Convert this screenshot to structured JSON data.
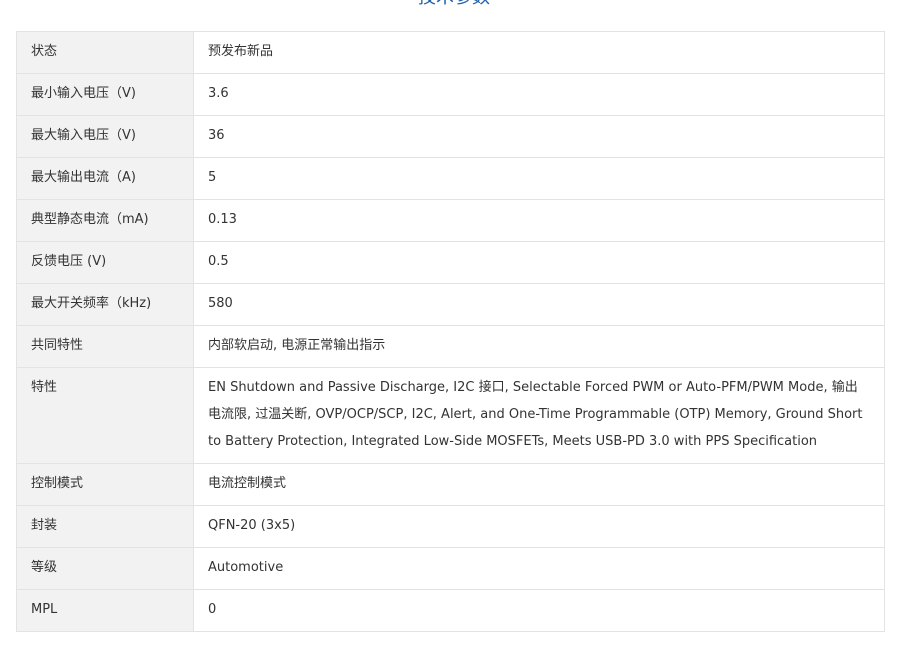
{
  "section": {
    "title": "技术参数"
  },
  "specs": [
    {
      "key": "状态",
      "value": "预发布新品"
    },
    {
      "key": "最小输入电压（V)",
      "value": "3.6"
    },
    {
      "key": "最大输入电压（V)",
      "value": "36"
    },
    {
      "key": "最大输出电流（A)",
      "value": "5"
    },
    {
      "key": "典型静态电流（mA)",
      "value": "0.13"
    },
    {
      "key": "反馈电压 (V)",
      "value": "0.5"
    },
    {
      "key": "最大开关频率（kHz)",
      "value": "580"
    },
    {
      "key": "共同特性",
      "value": "内部软启动, 电源正常输出指示"
    },
    {
      "key": "特性",
      "value": "EN Shutdown and Passive Discharge, I2C 接口, Selectable Forced PWM or Auto-PFM/PWM Mode, 输出电流限, 过温关断, OVP/OCP/SCP, I2C, Alert, and One-Time Programmable (OTP) Memory, Ground Short to Battery Protection, Integrated Low-Side MOSFETs, Meets USB-PD 3.0 with PPS Specification"
    },
    {
      "key": "控制模式",
      "value": "电流控制模式"
    },
    {
      "key": "封装",
      "value": "QFN-20 (3x5)"
    },
    {
      "key": "等级",
      "value": "Automotive"
    },
    {
      "key": "MPL",
      "value": "0"
    }
  ]
}
